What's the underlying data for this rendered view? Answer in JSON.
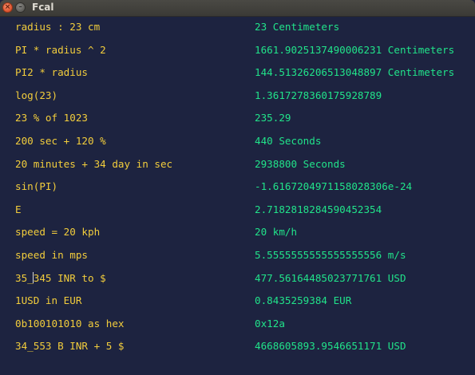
{
  "window": {
    "title": "Fcal",
    "close_glyph": "×",
    "minimize_glyph": "–"
  },
  "colors": {
    "background": "#1d2340",
    "expression": "#f2cd3c",
    "result": "#21e38a"
  },
  "rows": [
    {
      "expr": "radius : 23 cm",
      "result": "23 Centimeters"
    },
    {
      "expr": "PI * radius ^ 2",
      "result": "1661.9025137490006231 Centimeters"
    },
    {
      "expr": "PI2 * radius",
      "result": "144.51326206513048897 Centimeters"
    },
    {
      "expr": "log(23)",
      "result": "1.3617278360175928789"
    },
    {
      "expr": "23 % of 1023",
      "result": "235.29"
    },
    {
      "expr": "200 sec + 120 %",
      "result": "440 Seconds"
    },
    {
      "expr": "20 minutes + 34 day in sec",
      "result": "2938800 Seconds"
    },
    {
      "expr": "sin(PI)",
      "result": "-1.6167204971158028306e-24"
    },
    {
      "expr": "E",
      "result": "2.7182818284590452354"
    },
    {
      "expr": "speed = 20 kph",
      "result": "20 km/h"
    },
    {
      "expr": "speed in mps",
      "result": "5.5555555555555555556 m/s"
    },
    {
      "expr_before_cursor": "35_",
      "expr_after_cursor": "345 INR to $",
      "result": "477.56164485023771761 USD"
    },
    {
      "expr": "1USD in EUR",
      "result": "0.8435259384 EUR"
    },
    {
      "expr": "0b100101010 as hex",
      "result": "0x12a"
    },
    {
      "expr": "34_553 B INR + 5 $",
      "result": "4668605893.9546651171 USD"
    }
  ]
}
